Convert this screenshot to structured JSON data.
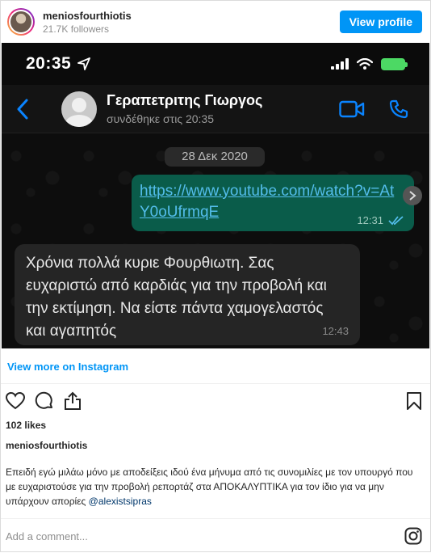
{
  "header": {
    "username": "meniosfourthiotis",
    "followers": "21.7K followers",
    "view_profile_label": "View profile"
  },
  "phone": {
    "status_time": "20:35",
    "contact_name": "Γεραπετριτης Γιωργος",
    "contact_status": "συνδέθηκε στις 20:35",
    "date_label": "28 Δεκ 2020",
    "outgoing_message": {
      "text": "https://www.youtube.com/watch?v=AtY0oUfrmqE",
      "time": "12:31"
    },
    "incoming_message": {
      "text": "Χρόνια πολλά κυριε Φουρθιωτη. Σας ευχαριστώ από καρδιάς για την προβολή και την εκτίμηση. Να είστε πάντα χαμογελαστός και αγαπητός",
      "time": "12:43"
    }
  },
  "post": {
    "view_more_label": "View more on Instagram",
    "likes": "102 likes",
    "author": "meniosfourthiotis",
    "caption": "Επειδή εγώ μιλάω μόνο με αποδείξεις ιδού ένα μήνυμα από τις συνομιλίες με τον υπουργό που με ευχαριστούσε για την προβολή ρεπορτάζ στα ΑΠΟΚΑΛΥΠΤΙΚΑ για τον ίδιο για να μην υπάρχουν απορίες",
    "mention": "@alexistsipras",
    "comment_placeholder": "Add a comment..."
  },
  "colors": {
    "brand_blue": "#0095f6",
    "whatsapp_out_bubble": "#0a5c4a",
    "whatsapp_in_bubble": "#252525",
    "ios_blue": "#0a84ff"
  }
}
